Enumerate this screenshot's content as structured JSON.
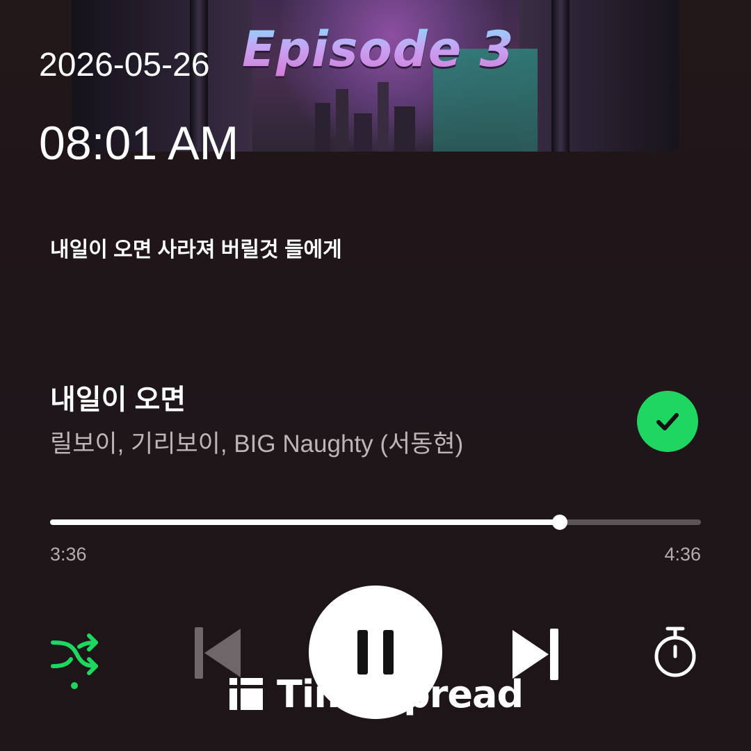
{
  "album_art": {
    "overlay_text": "Episode 3"
  },
  "overlay": {
    "date": "2026-05-26",
    "time": "08:01 AM"
  },
  "lyrics": {
    "current_line": "내일이 오면 사라져 버릴것 들에게"
  },
  "track": {
    "title": "내일이 오면",
    "artists": "릴보이, 기리보이, BIG Naughty (서동현)",
    "liked": true
  },
  "playback": {
    "elapsed": "3:36",
    "total": "4:36",
    "progress_fraction": 0.783,
    "is_playing": true,
    "shuffle_enabled": true
  },
  "controls": {
    "icons": [
      "shuffle-icon",
      "previous-icon",
      "pause-icon",
      "next-icon",
      "sleep-timer-icon"
    ]
  },
  "watermark": {
    "text": "TimeSpread",
    "icon": "timespread-logo-icon"
  },
  "colors": {
    "background": "#1f161a",
    "accent_green": "#1ed760",
    "secondary_text": "#bdb5b8",
    "progress_track": "#5d5558",
    "disabled_control": "#6e6669"
  }
}
